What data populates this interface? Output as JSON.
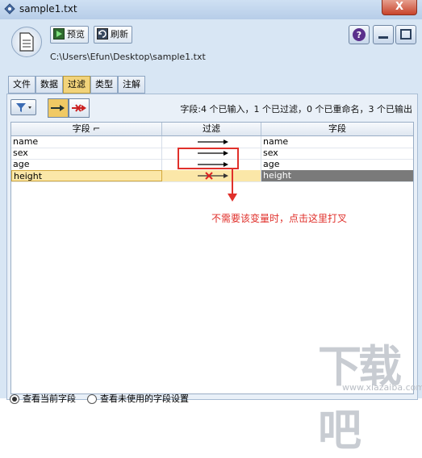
{
  "window": {
    "title": "sample1.txt",
    "close_label": "X"
  },
  "toolbar": {
    "preview_label": "预览",
    "refresh_label": "刷新"
  },
  "file_path": "C:\\Users\\Efun\\Desktop\\sample1.txt",
  "tabs": [
    {
      "label": "文件"
    },
    {
      "label": "数据"
    },
    {
      "label": "过滤"
    },
    {
      "label": "类型"
    },
    {
      "label": "注解"
    }
  ],
  "active_tab": "过滤",
  "filter_summary": "字段:4 个已输入，1 个已过滤，0 个已重命名，3 个已输出",
  "table": {
    "columns": [
      "字段 ⌐",
      "过滤",
      "字段"
    ],
    "rows": [
      {
        "field_in": "name",
        "filter": "pass",
        "field_out": "name"
      },
      {
        "field_in": "sex",
        "filter": "pass",
        "field_out": "sex"
      },
      {
        "field_in": "age",
        "filter": "pass",
        "field_out": "age"
      },
      {
        "field_in": "height",
        "filter": "filtered",
        "field_out": "height"
      }
    ]
  },
  "annotation": {
    "text": "不需要该变量时，点击这里打叉",
    "color": "#e0302b"
  },
  "footer": {
    "radio1_label": "查看当前字段",
    "radio2_label": "查看未使用的字段设置"
  },
  "watermark": {
    "text": "下载吧",
    "url_text": "www.xiazaiba.com"
  },
  "colors": {
    "accent_tab": "#f2d37a",
    "selected_row": "#fbe7a8",
    "output_selected": "#7a7a7a"
  },
  "icons": [
    "app-icon",
    "document-icon",
    "play-icon",
    "refresh-icon",
    "help-icon",
    "minimize-icon",
    "maximize-icon",
    "filter-icon",
    "arrow-icon",
    "cross-icon"
  ]
}
